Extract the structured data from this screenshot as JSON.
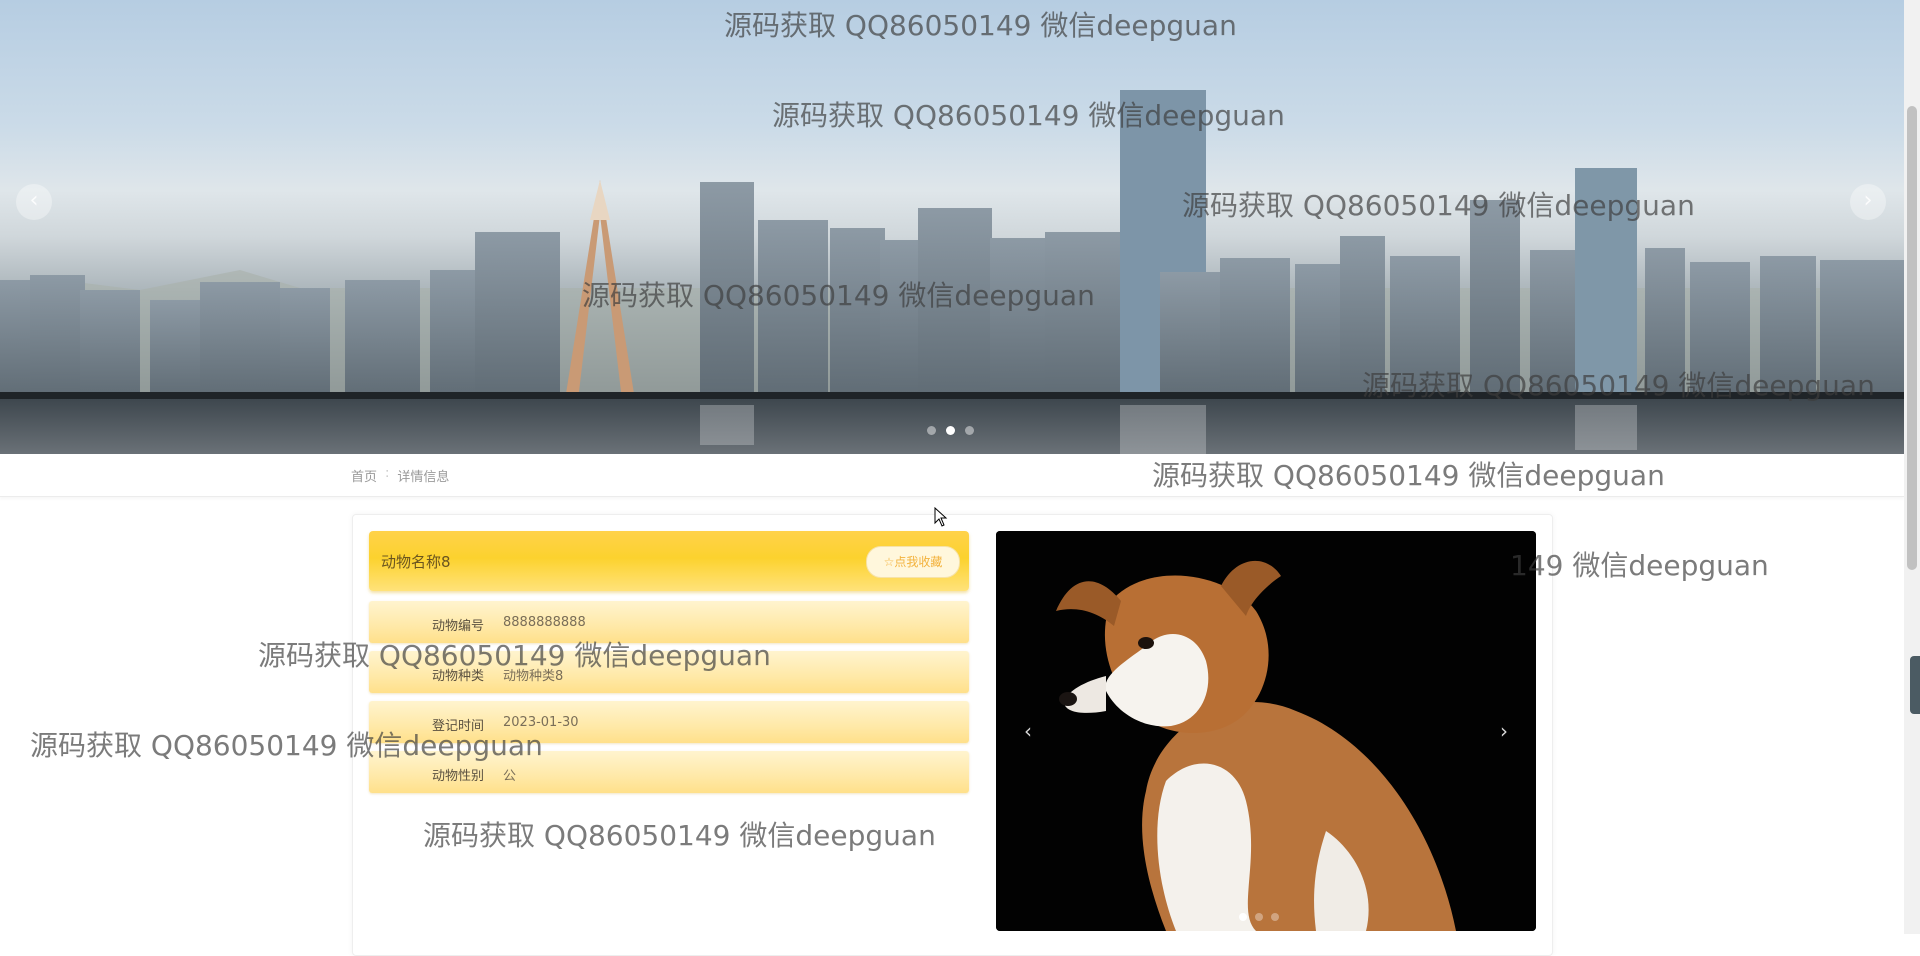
{
  "banner": {
    "prev_label": "‹",
    "next_label": "›",
    "slides": 3,
    "active_slide": 2
  },
  "breadcrumb": {
    "home": "首页",
    "separator": ":",
    "current": "详情信息"
  },
  "detail": {
    "title": "动物名称8",
    "favorite_button": "☆点我收藏",
    "fields": [
      {
        "label": "动物编号",
        "value": "8888888888"
      },
      {
        "label": "动物种类",
        "value": "动物种类8"
      },
      {
        "label": "登记时间",
        "value": "2023-01-30"
      },
      {
        "label": "动物性别",
        "value": "公"
      }
    ]
  },
  "gallery": {
    "prev_label": "‹",
    "next_label": "›",
    "slides": 3,
    "active_slide": 1
  },
  "watermark": "源码获取 QQ86050149 微信deepguan",
  "watermark_partial": "149 微信deepguan",
  "colors": {
    "title_bar": "#fcd22e",
    "info_row": "#ffe9a8",
    "favorite_text": "#f3b23c"
  }
}
